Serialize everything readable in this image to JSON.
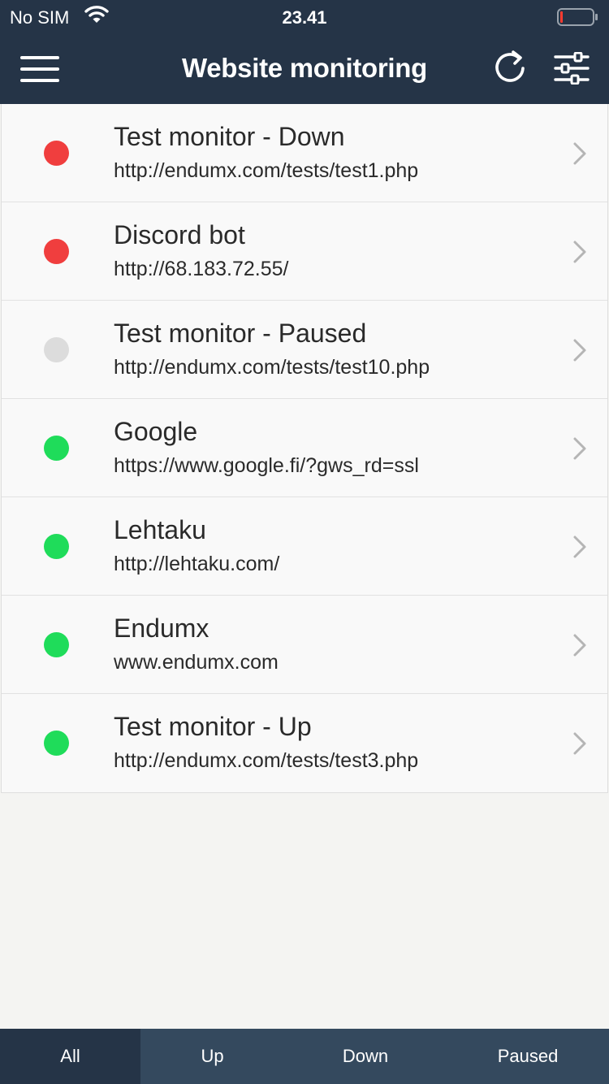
{
  "status_bar": {
    "carrier": "No SIM",
    "time": "23.41",
    "wifi_icon": "wifi-icon",
    "battery_icon": "battery-low-icon"
  },
  "header": {
    "title": "Website monitoring",
    "menu_icon": "hamburger-menu-icon",
    "refresh_icon": "refresh-icon",
    "settings_icon": "sliders-icon"
  },
  "colors": {
    "header_bg": "#253447",
    "tabbar_bg": "#34495e",
    "status_down": "#f03e3e",
    "status_paused": "#dcdcdc",
    "status_up": "#1fdc5a"
  },
  "monitors": [
    {
      "name": "Test monitor - Down",
      "url": "http://endumx.com/tests/test1.php",
      "status": "down"
    },
    {
      "name": "Discord bot",
      "url": "http://68.183.72.55/",
      "status": "down"
    },
    {
      "name": "Test monitor - Paused",
      "url": "http://endumx.com/tests/test10.php",
      "status": "paused"
    },
    {
      "name": "Google",
      "url": "https://www.google.fi/?gws_rd=ssl",
      "status": "up"
    },
    {
      "name": "Lehtaku",
      "url": "http://lehtaku.com/",
      "status": "up"
    },
    {
      "name": "Endumx",
      "url": "www.endumx.com",
      "status": "up"
    },
    {
      "name": "Test monitor - Up",
      "url": "http://endumx.com/tests/test3.php",
      "status": "up"
    }
  ],
  "tabs": [
    {
      "label": "All",
      "active": true
    },
    {
      "label": "Up",
      "active": false
    },
    {
      "label": "Down",
      "active": false
    },
    {
      "label": "Paused",
      "active": false
    }
  ]
}
